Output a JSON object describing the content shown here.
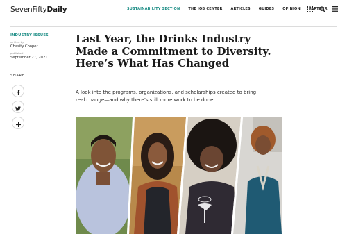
{
  "header": {
    "logo_part1": "SevenFifty",
    "logo_part2": "Daily",
    "nav": [
      {
        "label": "SUSTAINABILITY SECTION",
        "active": true
      },
      {
        "label": "THE JOB CENTER",
        "active": false
      },
      {
        "label": "ARTICLES",
        "active": false
      },
      {
        "label": "GUIDES",
        "active": false
      },
      {
        "label": "OPINION",
        "active": false
      },
      {
        "label": "PARTNER",
        "active": false
      }
    ],
    "icons": [
      "grid-icon",
      "search-icon",
      "menu-icon"
    ],
    "accent_color": "#1a8c84"
  },
  "sidebar": {
    "tag": "INDUSTRY ISSUES",
    "written_by_label": "written by",
    "author": "Chasity Cooper",
    "published_label": "published",
    "date": "September 27, 2021",
    "share_label": "SHARE",
    "share_icons": [
      "facebook-icon",
      "twitter-icon",
      "plus-icon"
    ]
  },
  "article": {
    "headline_lines": [
      "Last Year, the Drinks Industry",
      "Made a Commitment to Diversity.",
      "Here’s What Has Changed"
    ],
    "dek_lines": [
      "A look into the programs, organizations, and scholarships created to bring",
      "real change—and why there’s still more work to be done"
    ]
  }
}
